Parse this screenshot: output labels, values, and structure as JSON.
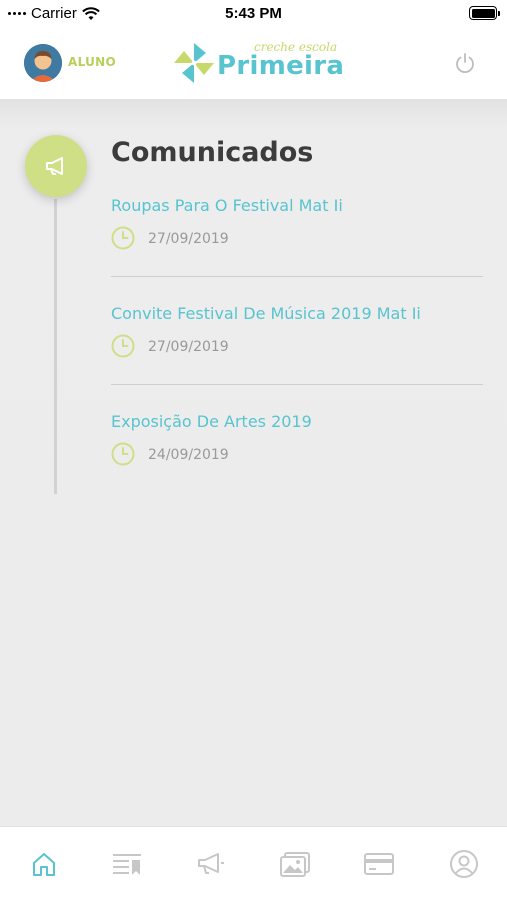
{
  "status_bar": {
    "carrier": "Carrier",
    "time": "5:43 PM"
  },
  "header": {
    "user_label": "ALUNO",
    "logo_script": "creche escola",
    "logo_word": "Primeira"
  },
  "main": {
    "title": "Comunicados",
    "items": [
      {
        "title": "Roupas Para O Festival Mat Ii",
        "date": "27/09/2019"
      },
      {
        "title": "Convite Festival De Música 2019 Mat Ii",
        "date": "27/09/2019"
      },
      {
        "title": "Exposição De Artes 2019",
        "date": "24/09/2019"
      }
    ]
  },
  "tabbar": {
    "tabs": [
      {
        "icon": "home-icon",
        "active": true
      },
      {
        "icon": "list-bookmark-icon",
        "active": false
      },
      {
        "icon": "megaphone-icon",
        "active": false
      },
      {
        "icon": "gallery-icon",
        "active": false
      },
      {
        "icon": "card-icon",
        "active": false
      },
      {
        "icon": "profile-icon",
        "active": false
      }
    ]
  },
  "colors": {
    "accent_teal": "#57c4cf",
    "accent_green": "#cfdf86",
    "inactive_icon": "#c7c7c7"
  }
}
